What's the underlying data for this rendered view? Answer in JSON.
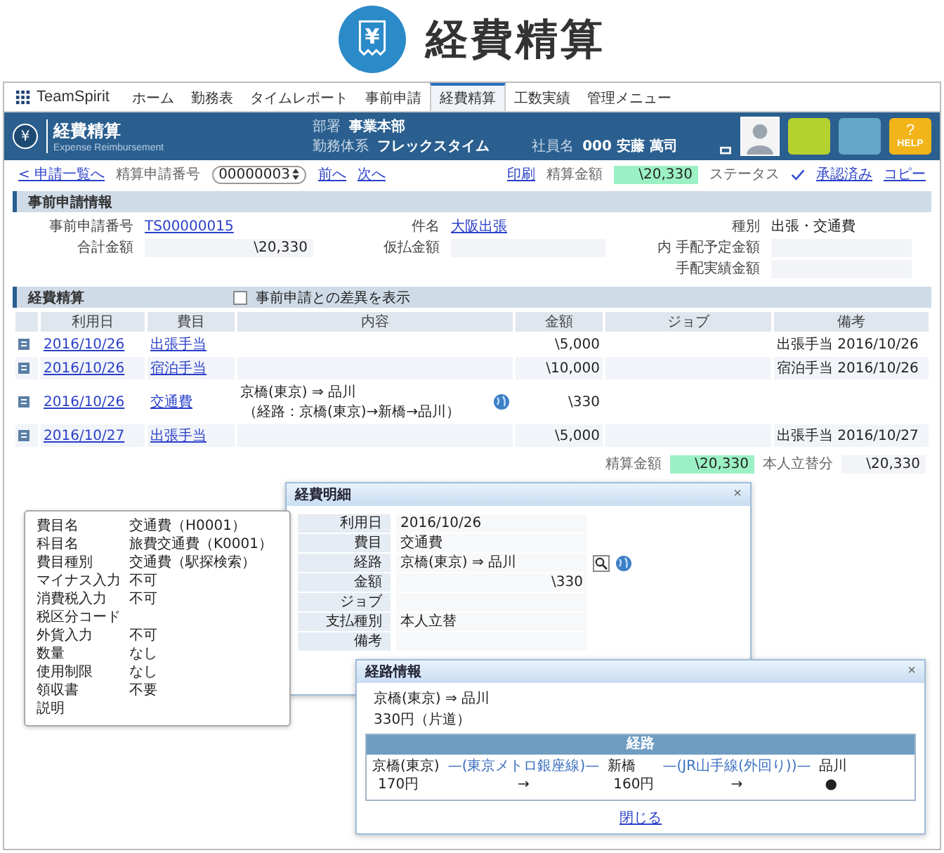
{
  "hero": {
    "icon_glyph": "¥",
    "title": "経費精算"
  },
  "nav": {
    "logo": "TeamSpirit",
    "tabs": [
      {
        "label": "ホーム",
        "selected": false
      },
      {
        "label": "勤務表",
        "selected": false
      },
      {
        "label": "タイムレポート",
        "selected": false
      },
      {
        "label": "事前申請",
        "selected": false
      },
      {
        "label": "経費精算",
        "selected": true
      },
      {
        "label": "工数実績",
        "selected": false
      },
      {
        "label": "管理メニュー",
        "selected": false
      }
    ]
  },
  "header": {
    "icon_glyph": "¥",
    "title": "経費精算",
    "subtitle": "Expense Reimbursement",
    "fields": [
      {
        "label": "部署",
        "value": "事業本部"
      },
      {
        "label": "勤務体系",
        "value": "フレックスタイム"
      }
    ],
    "employee": {
      "label": "社員名",
      "value": "000 安藤 萬司"
    },
    "tiles": [
      {
        "color": "#b5d12f"
      },
      {
        "color": "#64a7c8"
      },
      {
        "color": "#f2b418",
        "glyph": "?",
        "label": "HELP"
      }
    ]
  },
  "toolbar": {
    "back_link": "< 申請一覧へ",
    "number_label": "精算申請番号",
    "number_value": "00000003",
    "prev": "前へ",
    "next": "次へ",
    "print": "印刷",
    "amount_label": "精算金額",
    "amount": "\\20,330",
    "status_label": "ステータス",
    "status": "承認済み",
    "copy": "コピー"
  },
  "pre_application": {
    "title": "事前申請情報",
    "columns": [
      [
        {
          "label": "事前申請番号",
          "value": "TS00000015",
          "kind": "link"
        },
        {
          "label": "合計金額",
          "value": "\\20,330",
          "kind": "amount"
        }
      ],
      [
        {
          "label": "件名",
          "value": "大阪出張",
          "kind": "link"
        },
        {
          "label": "仮払金額",
          "kind": "amount"
        }
      ],
      [
        {
          "label": "種別",
          "value": "出張・交通費",
          "kind": "text"
        },
        {
          "label": "内 手配予定金額",
          "kind": "amount"
        },
        {
          "label": "手配実績金額",
          "kind": "amount"
        }
      ]
    ]
  },
  "expenses": {
    "title": "経費精算",
    "diff_checkbox": {
      "label": "事前申請との差異を表示",
      "checked": false
    },
    "columns": [
      "利用日",
      "費目",
      "内容",
      "金額",
      "ジョブ",
      "備考"
    ],
    "rows": [
      {
        "date": "2016/10/26",
        "item": "出張手当",
        "amount": "\\5,000",
        "note": "出張手当 2016/10/26",
        "map": false
      },
      {
        "date": "2016/10/26",
        "item": "宿泊手当",
        "amount": "\\10,000",
        "note": "宿泊手当 2016/10/26",
        "map": false
      },
      {
        "date": "2016/10/26",
        "item": "交通費",
        "content": "京橋(東京) ⇒ 品川",
        "route": "（経路：京橋(東京)→新橋→品川）",
        "map": true,
        "amount": "\\330"
      },
      {
        "date": "2016/10/27",
        "item": "出張手当",
        "amount": "\\5,000",
        "note": "出張手当 2016/10/27",
        "map": false
      }
    ],
    "total": {
      "label": "精算金額",
      "value": "\\20,330",
      "own_label": "本人立替分",
      "own_value": "\\20,330"
    }
  },
  "detail_dialog": {
    "title": "経費明細",
    "close": "×",
    "fields": [
      {
        "label": "利用日",
        "value": "2016/10/26",
        "kind": "text"
      },
      {
        "label": "費目",
        "value": "交通費",
        "kind": "text"
      },
      {
        "label": "経路",
        "value": "京橋(東京) ⇒ 品川",
        "kind": "route"
      },
      {
        "label": "金額",
        "value": "\\330",
        "kind": "amount"
      },
      {
        "label": "ジョブ",
        "kind": "text"
      },
      {
        "label": "支払種別",
        "value": "本人立替",
        "kind": "text"
      },
      {
        "label": "備考",
        "kind": "text"
      }
    ]
  },
  "item_tooltip": {
    "rows": [
      {
        "label": "費目名",
        "value": "交通費（H0001）"
      },
      {
        "label": "科目名",
        "value": "旅費交通費（K0001）"
      },
      {
        "label": "費目種別",
        "value": "交通費（駅探検索）"
      },
      {
        "label": "マイナス入力",
        "value": "不可"
      },
      {
        "label": "消費税入力",
        "value": "不可"
      },
      {
        "label": "税区分コード"
      },
      {
        "label": "外貨入力",
        "value": "不可"
      },
      {
        "label": "数量",
        "value": "なし"
      },
      {
        "label": "使用制限",
        "value": "なし"
      },
      {
        "label": "領収書",
        "value": "不要"
      },
      {
        "label": "説明"
      }
    ]
  },
  "route_dialog": {
    "title": "経路情報",
    "close": "×",
    "summary": "京橋(東京) ⇒ 品川",
    "fare": "330円（片道）",
    "table_title": "経路",
    "segments": [
      {
        "kind": "station",
        "name": "京橋(東京)",
        "below": "170円"
      },
      {
        "kind": "line",
        "name": "—(東京メトロ銀座線)—",
        "below": "→"
      },
      {
        "kind": "station",
        "name": "新橋",
        "below": "160円"
      },
      {
        "kind": "line",
        "name": "—(JR山手線(外回り))—",
        "below": "→"
      },
      {
        "kind": "station",
        "name": "品川",
        "below": "●"
      }
    ],
    "close_link": "閉じる"
  }
}
